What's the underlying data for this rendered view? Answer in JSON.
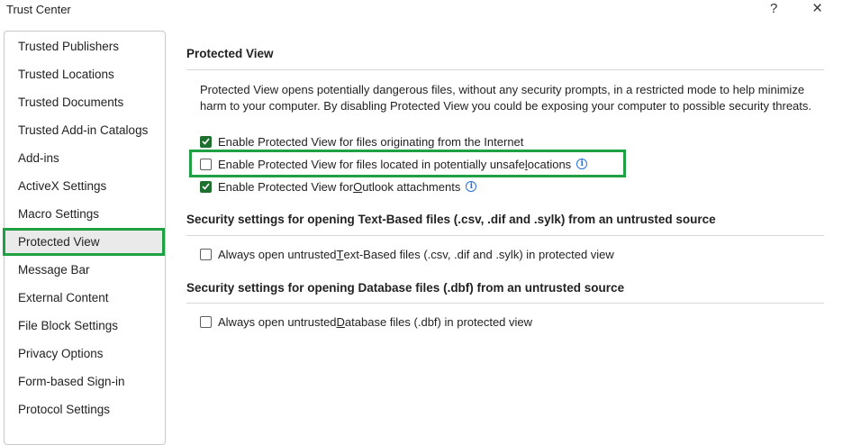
{
  "window": {
    "title": "Trust Center",
    "help_label": "?",
    "close_label": "×"
  },
  "sidebar": {
    "items": [
      {
        "label": "Trusted Publishers"
      },
      {
        "label": "Trusted Locations"
      },
      {
        "label": "Trusted Documents"
      },
      {
        "label": "Trusted Add-in Catalogs"
      },
      {
        "label": "Add-ins"
      },
      {
        "label": "ActiveX Settings"
      },
      {
        "label": "Macro Settings"
      },
      {
        "label": "Protected View",
        "selected": true
      },
      {
        "label": "Message Bar"
      },
      {
        "label": "External Content"
      },
      {
        "label": "File Block Settings"
      },
      {
        "label": "Privacy Options"
      },
      {
        "label": "Form-based Sign-in"
      },
      {
        "label": "Protocol Settings"
      }
    ]
  },
  "main": {
    "protected_view": {
      "heading": "Protected View",
      "description": "Protected View opens potentially dangerous files, without any security prompts, in a restricted mode to help minimize harm to your computer. By disabling Protected View you could be exposing your computer to possible security threats.",
      "options": [
        {
          "pre": "Enable Protected View for files originating from the Internet",
          "u": "",
          "post": "",
          "checked": true,
          "info": false
        },
        {
          "pre": "Enable Protected View for files located in potentially unsafe ",
          "u": "l",
          "post": "ocations",
          "checked": false,
          "info": true
        },
        {
          "pre": "Enable Protected View for ",
          "u": "O",
          "post": "utlook attachments",
          "checked": true,
          "info": true
        }
      ]
    },
    "text_based": {
      "heading": "Security settings for opening Text-Based files (.csv, .dif and .sylk) from an untrusted source",
      "option": {
        "pre": "Always open untrusted ",
        "u": "T",
        "post": "ext-Based files (.csv, .dif and .sylk) in protected view",
        "checked": false
      }
    },
    "database": {
      "heading": "Security settings for opening Database files (.dbf) from an untrusted source",
      "option": {
        "pre": "Always open untrusted ",
        "u": "D",
        "post": "atabase files (.dbf) in protected view",
        "checked": false
      }
    }
  },
  "colors": {
    "highlight": "#1ea043",
    "checkbox_checked": "#1f6f2f",
    "info_icon": "#2b6fd6"
  }
}
